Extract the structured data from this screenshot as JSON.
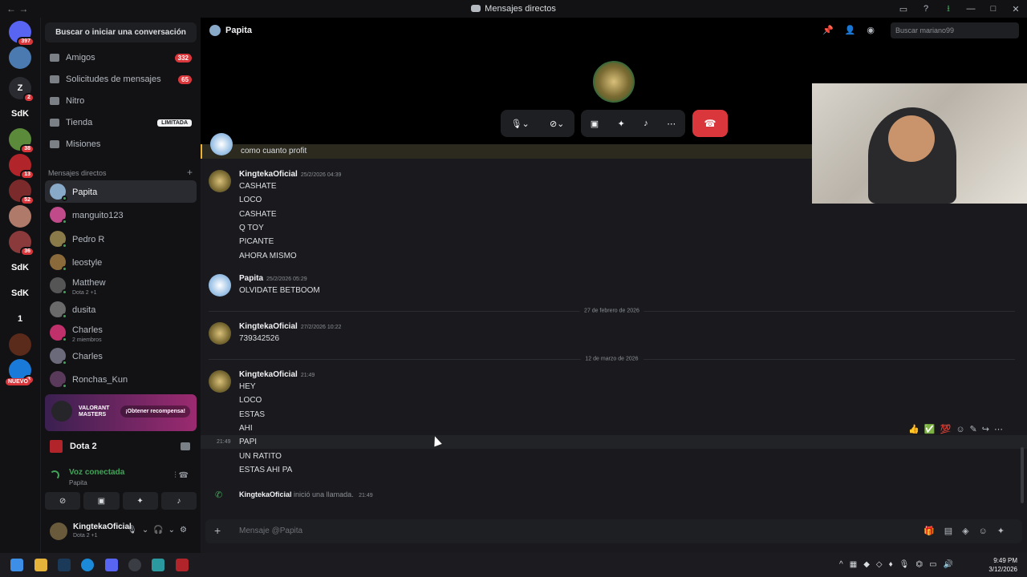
{
  "titlebar": {
    "title": "Mensajes directos",
    "back": "← →"
  },
  "guilds": [
    {
      "label": "",
      "badge": "397",
      "color": "#5865f2"
    },
    {
      "label": "",
      "badge": "",
      "color": "#4a7ab0"
    },
    {
      "label": "Z",
      "badge": "2",
      "color": "#2a2b30"
    },
    {
      "label": "SdK",
      "badge": "",
      "color": ""
    },
    {
      "label": "",
      "badge": "38",
      "color": "#5a8a3a"
    },
    {
      "label": "",
      "badge": "13",
      "color": "#b0242a"
    },
    {
      "label": "",
      "badge": "52",
      "color": "#7a2a2a"
    },
    {
      "label": "",
      "badge": "",
      "color": "#b07a6a"
    },
    {
      "label": "",
      "badge": "36",
      "color": "#8a3a3a"
    },
    {
      "label": "SdK",
      "badge": "",
      "color": ""
    },
    {
      "label": "SdK",
      "badge": "",
      "color": ""
    },
    {
      "label": "1",
      "badge": "",
      "color": ""
    },
    {
      "label": "",
      "badge": "",
      "color": "#5a2a1a"
    },
    {
      "label": "",
      "badge": "3",
      "color": "#1a7ad9"
    }
  ],
  "nuevo": "NUEVO",
  "search_button": "Buscar o iniciar una conversación",
  "nav": [
    {
      "label": "Amigos",
      "badge": "332",
      "lim": false
    },
    {
      "label": "Solicitudes de mensajes",
      "badge": "65",
      "lim": false
    },
    {
      "label": "Nitro",
      "badge": "",
      "lim": false
    },
    {
      "label": "Tienda",
      "badge": "LIMITADA",
      "lim": true
    },
    {
      "label": "Misiones",
      "badge": "",
      "lim": false
    }
  ],
  "dm_header": "Mensajes directos",
  "dms": [
    {
      "name": "Papita",
      "sub": "",
      "active": true
    },
    {
      "name": "manguito123",
      "sub": ""
    },
    {
      "name": "Pedro R",
      "sub": ""
    },
    {
      "name": "leostyle",
      "sub": ""
    },
    {
      "name": "Matthew",
      "sub": "Dota 2 +1"
    },
    {
      "name": "dusita",
      "sub": ""
    },
    {
      "name": "Charles",
      "sub": "2 miembros"
    },
    {
      "name": "Charles",
      "sub": ""
    },
    {
      "name": "Ronchas_Kun",
      "sub": ""
    }
  ],
  "promo": {
    "title": "VALORANT MASTERS",
    "button": "¡Obtener recompensa!"
  },
  "game": "Dota 2",
  "voice": {
    "status": "Voz conectada",
    "channel": "Papita"
  },
  "user": {
    "name": "KingtekaOficial",
    "status": "Dota 2 +1"
  },
  "header": {
    "channel": "Papita",
    "search_placeholder": "Buscar mariano99"
  },
  "chat": {
    "highlight": "como cuanto profit",
    "messages": [
      {
        "author": "KingtekaOficial",
        "time": "25/2/2026 04:39",
        "lines": [
          "CASHATE",
          "LOCO",
          "CASHATE",
          "Q TOY",
          "PICANTE",
          "AHORA MISMO"
        ]
      },
      {
        "author": "Papita",
        "time": "25/2/2026 05:29",
        "lines": [
          "OLVIDATE BETBOOM"
        ]
      },
      {
        "author": "KingtekaOficial",
        "time": "27/2/2026 10:22",
        "lines": [
          "739342526"
        ]
      },
      {
        "author": "KingtekaOficial",
        "time": "21:49",
        "lines": [
          "HEY",
          "LOCO",
          "ESTAS",
          "AHI",
          "PAPI",
          "UN RATITO",
          "ESTAS AHI PA"
        ]
      }
    ],
    "sep1": "27 de febrero de 2026",
    "sep2": "12 de marzo de 2026",
    "hover_time": "21:49",
    "call_author": "KingtekaOficial",
    "call_text": "inició una llamada.",
    "call_time": "21:49"
  },
  "input_placeholder": "Mensaje @Papita",
  "clock": {
    "time": "9:49 PM",
    "date": "3/12/2026"
  }
}
